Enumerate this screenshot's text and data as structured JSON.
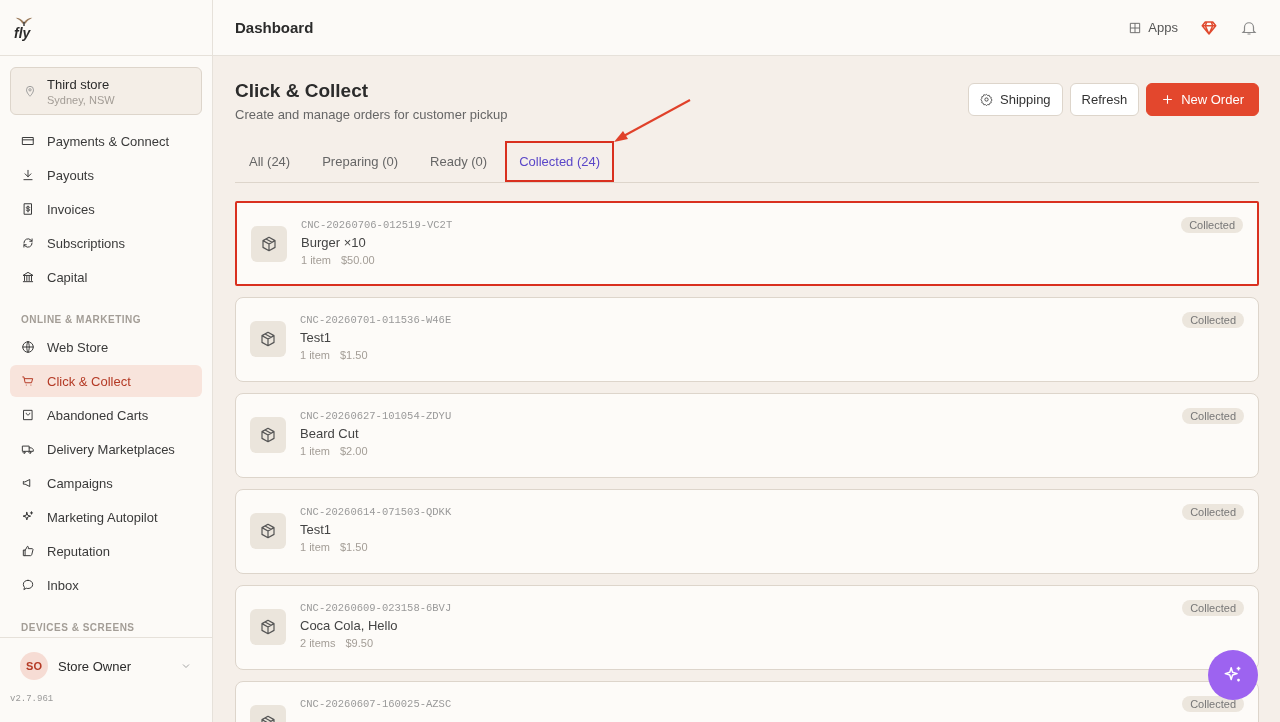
{
  "logo": {
    "text": "fly"
  },
  "store": {
    "name": "Third store",
    "location": "Sydney, NSW"
  },
  "nav_sections": [
    {
      "items": [
        {
          "label": "Payments & Connect",
          "selected": false
        },
        {
          "label": "Payouts",
          "selected": false
        },
        {
          "label": "Invoices",
          "selected": false
        },
        {
          "label": "Subscriptions",
          "selected": false
        },
        {
          "label": "Capital",
          "selected": false
        }
      ]
    },
    {
      "heading": "ONLINE & MARKETING",
      "items": [
        {
          "label": "Web Store",
          "selected": false
        },
        {
          "label": "Click & Collect",
          "selected": true
        },
        {
          "label": "Abandoned Carts",
          "selected": false
        },
        {
          "label": "Delivery Marketplaces",
          "selected": false
        },
        {
          "label": "Campaigns",
          "selected": false
        },
        {
          "label": "Marketing Autopilot",
          "selected": false
        },
        {
          "label": "Reputation",
          "selected": false
        },
        {
          "label": "Inbox",
          "selected": false
        }
      ]
    },
    {
      "heading": "DEVICES & SCREENS"
    }
  ],
  "user": {
    "initials": "SO",
    "name": "Store Owner"
  },
  "version": "v2.7.961",
  "header": {
    "title": "Dashboard",
    "apps": "Apps"
  },
  "page": {
    "title": "Click & Collect",
    "subtitle": "Create and manage orders for customer pickup"
  },
  "buttons": [
    {
      "label": "Shipping",
      "kind": "settings"
    },
    {
      "label": "Refresh",
      "kind": "plain"
    },
    {
      "label": "New Order",
      "kind": "primary"
    }
  ],
  "tabs": [
    {
      "label": "All (24)",
      "selected": false,
      "highlighted": false
    },
    {
      "label": "Preparing (0)",
      "selected": false,
      "highlighted": false
    },
    {
      "label": "Ready (0)",
      "selected": false,
      "highlighted": false
    },
    {
      "label": "Collected (24)",
      "selected": true,
      "highlighted": true
    }
  ],
  "orders": [
    {
      "id": "CNC-20260706-012519-VC2T",
      "name": "Burger ×10",
      "items": "1 item",
      "total": "$50.00",
      "status": "Collected",
      "highlighted": true
    },
    {
      "id": "CNC-20260701-011536-W46E",
      "name": "Test1",
      "items": "1 item",
      "total": "$1.50",
      "status": "Collected",
      "highlighted": false
    },
    {
      "id": "CNC-20260627-101054-ZDYU",
      "name": "Beard Cut",
      "items": "1 item",
      "total": "$2.00",
      "status": "Collected",
      "highlighted": false
    },
    {
      "id": "CNC-20260614-071503-QDKK",
      "name": "Test1",
      "items": "1 item",
      "total": "$1.50",
      "status": "Collected",
      "highlighted": false
    },
    {
      "id": "CNC-20260609-023158-6BVJ",
      "name": "Coca Cola, Hello",
      "items": "2 items",
      "total": "$9.50",
      "status": "Collected",
      "highlighted": false
    },
    {
      "id": "CNC-20260607-160025-AZSC",
      "status": "Collected",
      "highlighted": false
    }
  ]
}
